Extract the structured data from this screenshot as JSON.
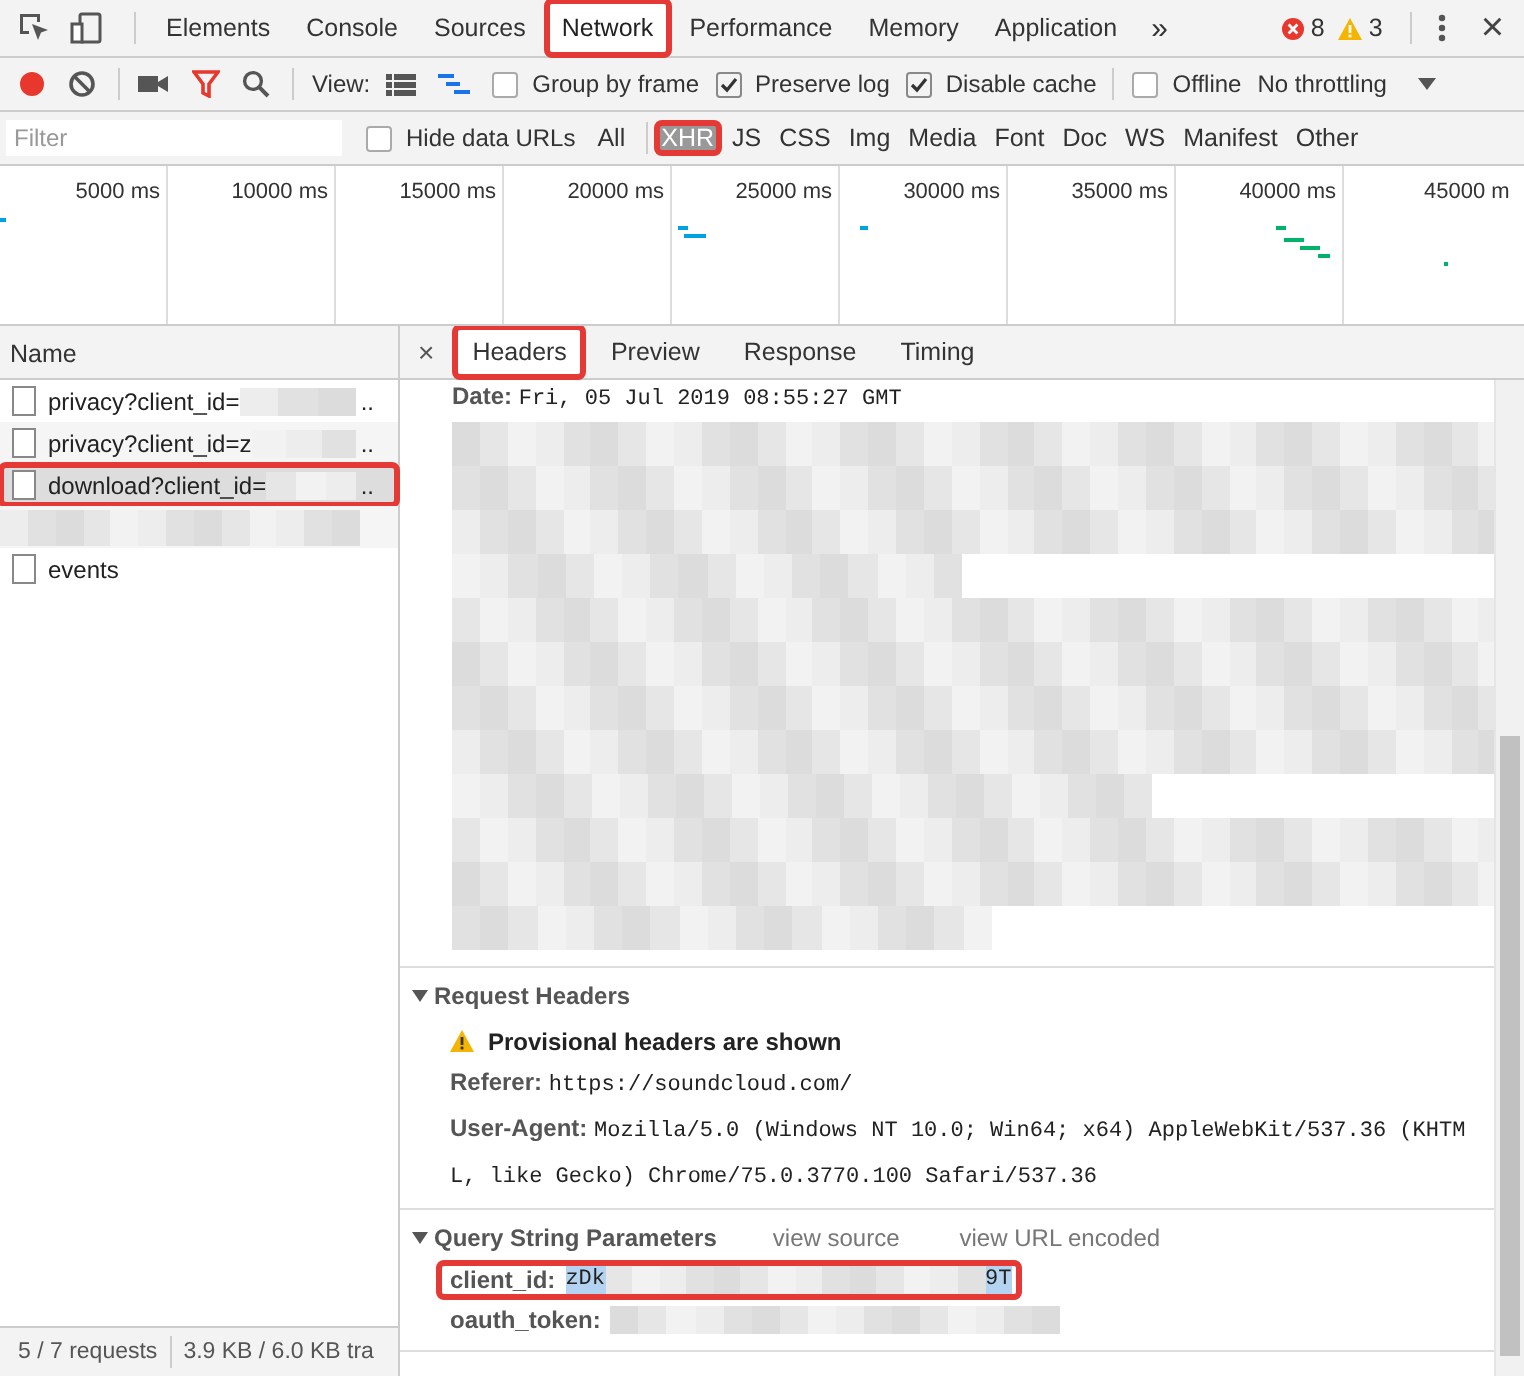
{
  "top_tabs": [
    {
      "label": "Elements",
      "selected": false,
      "highlighted": false
    },
    {
      "label": "Console",
      "selected": false,
      "highlighted": false
    },
    {
      "label": "Sources",
      "selected": false,
      "highlighted": false
    },
    {
      "label": "Network",
      "selected": true,
      "highlighted": true
    },
    {
      "label": "Performance",
      "selected": false,
      "highlighted": false
    },
    {
      "label": "Memory",
      "selected": false,
      "highlighted": false
    },
    {
      "label": "Application",
      "selected": false,
      "highlighted": false
    }
  ],
  "more": "»",
  "errors": "8",
  "warnings": "3",
  "close": "×",
  "toolbar": {
    "recording": true,
    "view_label": "View:",
    "checkboxes": [
      {
        "label": "Group by frame",
        "checked": false
      },
      {
        "label": "Preserve log",
        "checked": true
      },
      {
        "label": "Disable cache",
        "checked": true
      },
      {
        "label": "Offline",
        "checked": false
      }
    ],
    "throttling": "No throttling"
  },
  "filter_bar": {
    "placeholder": "Filter",
    "hide_data_urls": {
      "label": "Hide data URLs",
      "checked": false
    },
    "types": [
      {
        "label": "All",
        "selected": false,
        "highlighted": false
      },
      {
        "label": "XHR",
        "selected": true,
        "highlighted": true
      },
      {
        "label": "JS",
        "selected": false,
        "highlighted": false
      },
      {
        "label": "CSS",
        "selected": false,
        "highlighted": false
      },
      {
        "label": "Img",
        "selected": false,
        "highlighted": false
      },
      {
        "label": "Media",
        "selected": false,
        "highlighted": false
      },
      {
        "label": "Font",
        "selected": false,
        "highlighted": false
      },
      {
        "label": "Doc",
        "selected": false,
        "highlighted": false
      },
      {
        "label": "WS",
        "selected": false,
        "highlighted": false
      },
      {
        "label": "Manifest",
        "selected": false,
        "highlighted": false
      },
      {
        "label": "Other",
        "selected": false,
        "highlighted": false
      }
    ]
  },
  "overview": {
    "ticks": [
      "5000 ms",
      "10000 ms",
      "15000 ms",
      "20000 ms",
      "25000 ms",
      "30000 ms",
      "35000 ms",
      "40000 ms",
      "45000 m"
    ]
  },
  "requests": {
    "column": "Name",
    "rows": [
      {
        "kind": "request",
        "text": "privacy?client_id=",
        "redacted": true,
        "tail": "..",
        "selected": false,
        "highlighted": false
      },
      {
        "kind": "request",
        "text": "privacy?client_id=z",
        "redacted": true,
        "tail": "..",
        "selected": false,
        "highlighted": false
      },
      {
        "kind": "request",
        "text": "download?client_id=",
        "redacted": true,
        "tail": "..",
        "selected": true,
        "highlighted": true
      },
      {
        "kind": "redacted"
      },
      {
        "kind": "request",
        "text": "events",
        "redacted": false,
        "selected": false,
        "highlighted": false
      }
    ]
  },
  "details": {
    "close": "×",
    "tabs": [
      {
        "label": "Headers",
        "selected": true,
        "highlighted": true
      },
      {
        "label": "Preview",
        "selected": false,
        "highlighted": false
      },
      {
        "label": "Response",
        "selected": false,
        "highlighted": false
      },
      {
        "label": "Timing",
        "selected": false,
        "highlighted": false
      }
    ],
    "response_lines": [
      {
        "kind": "header",
        "name": "Date:",
        "value": "Fri, 05 Jul 2019 08:55:27 GMT"
      },
      {
        "kind": "redacted"
      },
      {
        "kind": "redacted"
      },
      {
        "kind": "redacted"
      },
      {
        "kind": "redacted"
      },
      {
        "kind": "redacted"
      },
      {
        "kind": "redacted"
      },
      {
        "kind": "redacted"
      },
      {
        "kind": "redacted"
      },
      {
        "kind": "redacted"
      },
      {
        "kind": "redacted"
      },
      {
        "kind": "redacted"
      },
      {
        "kind": "redacted"
      }
    ],
    "sections": [
      {
        "title": "Request Headers",
        "expanded": true,
        "warning": "Provisional headers are shown",
        "headers": [
          {
            "name": "Referer:",
            "value": "https://soundcloud.com/"
          },
          {
            "name": "User-Agent:",
            "value": "Mozilla/5.0 (Windows NT 10.0; Win64; x64) AppleWebKit/537.36 (KHTML, like Gecko) Chrome/75.0.3770.100 Safari/537.36"
          }
        ]
      },
      {
        "title": "Query String Parameters",
        "expanded": true,
        "links": [
          "view source",
          "view URL encoded"
        ],
        "params": [
          {
            "name": "client_id:",
            "value_start": "zDk",
            "value_end": "9T",
            "redacted": true,
            "selected": true,
            "highlighted": true
          },
          {
            "name": "oauth_token:",
            "redacted": true,
            "selected": false,
            "highlighted": false
          }
        ]
      }
    ]
  },
  "status_bar": [
    "5 / 7 requests",
    "3.9 KB / 6.0 KB tra"
  ]
}
